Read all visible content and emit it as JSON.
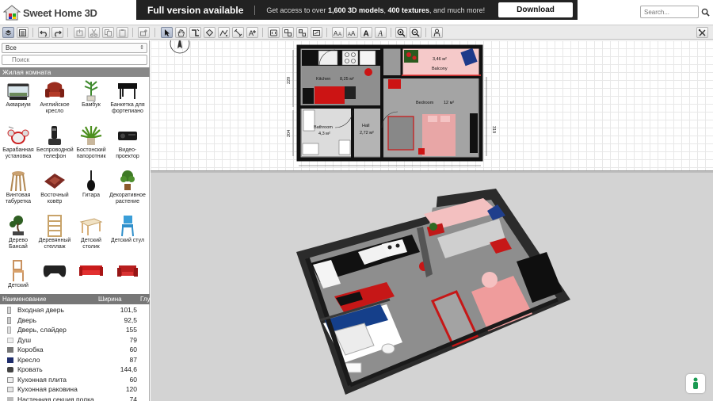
{
  "brand": {
    "name": "Sweet Home 3D"
  },
  "promo": {
    "title": "Full version available",
    "text_pre": "Get access to over ",
    "models": "1,600 3D models",
    "text_mid": ", ",
    "textures": "400 textures",
    "text_post": ", and much more!",
    "download_label": "Download"
  },
  "search": {
    "placeholder": "Search..."
  },
  "toolbar": {
    "buttons": [
      "view-mode",
      "preferences",
      "undo",
      "redo",
      "cut",
      "copy",
      "paste",
      "delete",
      "add-furniture",
      "select",
      "pan",
      "create-walls",
      "create-rooms",
      "create-polylines",
      "create-dimensions",
      "add-text",
      "import",
      "export",
      "group",
      "ungroup",
      "text-style-a1",
      "text-style-a2",
      "text-bold",
      "text-italic",
      "zoom-in",
      "zoom-out",
      "3d-view",
      "settings"
    ]
  },
  "catalog": {
    "category_selected": "Все",
    "search_placeholder": "Поиск",
    "section_title": "Жилая комната",
    "items": [
      {
        "label": "Аквариум",
        "icon": "aquarium-icon"
      },
      {
        "label": "Английское кресло",
        "icon": "armchair-icon"
      },
      {
        "label": "Бамбук",
        "icon": "bamboo-icon"
      },
      {
        "label": "Банкетка для фортепиано",
        "icon": "piano-bench-icon"
      },
      {
        "label": "Барабанная установка",
        "icon": "drum-kit-icon"
      },
      {
        "label": "Беспроводной телефон",
        "icon": "cordless-phone-icon"
      },
      {
        "label": "Бостонский папоротник",
        "icon": "fern-icon"
      },
      {
        "label": "Видео-проектор",
        "icon": "projector-icon"
      },
      {
        "label": "Винтовая табуретка",
        "icon": "stool-icon"
      },
      {
        "label": "Восточный ковёр",
        "icon": "rug-icon"
      },
      {
        "label": "Гитара",
        "icon": "guitar-icon"
      },
      {
        "label": "Декоративное растение",
        "icon": "plant-icon"
      },
      {
        "label": "Дерево Бансай",
        "icon": "bonsai-icon"
      },
      {
        "label": "Деревянный стеллаж",
        "icon": "shelf-icon"
      },
      {
        "label": "Детский столик",
        "icon": "kids-table-icon"
      },
      {
        "label": "Детский стул",
        "icon": "kids-chair-icon"
      },
      {
        "label": "Детский",
        "icon": "kids-chair-wood-icon"
      },
      {
        "label": "",
        "icon": "gamepad-icon"
      },
      {
        "label": "",
        "icon": "red-sofa-icon"
      },
      {
        "label": "",
        "icon": "red-armchair-icon"
      }
    ]
  },
  "furniture_table": {
    "columns": [
      "Наименование",
      "Ширина",
      "Глу"
    ],
    "rows": [
      {
        "name": "Входная дверь",
        "width": "101,5",
        "icon": "door-icon"
      },
      {
        "name": "Дверь",
        "width": "92,5",
        "icon": "door-icon"
      },
      {
        "name": "Дверь, слайдер",
        "width": "155",
        "icon": "sliding-door-icon"
      },
      {
        "name": "Душ",
        "width": "79",
        "icon": "shower-icon"
      },
      {
        "name": "Коробка",
        "width": "60",
        "icon": "box-icon"
      },
      {
        "name": "Кресло",
        "width": "87",
        "icon": "armchair-blue-icon"
      },
      {
        "name": "Кровать",
        "width": "144,6",
        "icon": "bed-icon"
      },
      {
        "name": "Кухонная плита",
        "width": "60",
        "icon": "cooker-icon"
      },
      {
        "name": "Кухонная раковина",
        "width": "120",
        "icon": "kitchen-sink-icon"
      },
      {
        "name": "Настенная секция полка",
        "width": "74",
        "icon": "wall-shelf-icon"
      }
    ]
  },
  "plan": {
    "rooms": [
      {
        "name": "Kitchen",
        "area": "8,25 м²"
      },
      {
        "name": "Balcony",
        "area": "3,46 м²"
      },
      {
        "name": "Bedroom",
        "area": "12 м²"
      },
      {
        "name": "Bathroom",
        "area": "4,3 м²"
      },
      {
        "name": "Hall",
        "area": "2,72 м²"
      }
    ],
    "dimensions": [
      "229",
      "204",
      "319"
    ]
  },
  "colors": {
    "promo_bg": "#222222",
    "accent_red": "#cc1414",
    "wall": "#111111",
    "floor_3d": "#8d8d8d",
    "view3d_bg": "#d3d3d3"
  }
}
